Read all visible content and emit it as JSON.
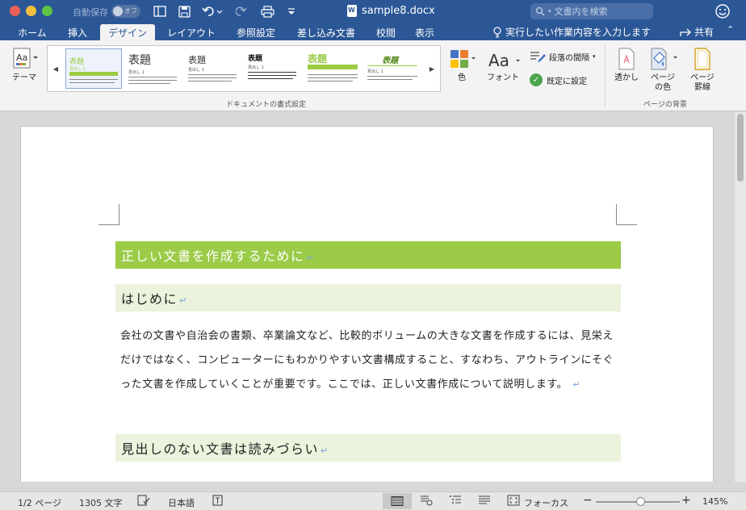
{
  "titlebar": {
    "autosave_label": "自動保存",
    "autosave_state": "オフ",
    "document_title": "sample8.docx",
    "search_placeholder": "文書内を検索"
  },
  "tabs": [
    {
      "label": "ホーム",
      "active": false
    },
    {
      "label": "挿入",
      "active": false
    },
    {
      "label": "デザイン",
      "active": true
    },
    {
      "label": "レイアウト",
      "active": false
    },
    {
      "label": "参照設定",
      "active": false
    },
    {
      "label": "差し込み文書",
      "active": false
    },
    {
      "label": "校閲",
      "active": false
    },
    {
      "label": "表示",
      "active": false
    }
  ],
  "tell_me": "実行したい作業内容を入力します",
  "share": "共有",
  "ribbon": {
    "theme_label": "テーマ",
    "gallery_heading": "表題",
    "gallery_subheading": "見出し 1",
    "group_document_format": "ドキュメントの書式設定",
    "color_label": "色",
    "font_label": "フォント",
    "paragraph_spacing": "段落の間隔",
    "set_default": "既定に設定",
    "watermark": "透かし",
    "page_color": "ページ\nの色",
    "page_borders": "ページ\n罫線",
    "group_page_background": "ページの背景"
  },
  "document": {
    "heading1": "正しい文書を作成するために",
    "heading2a": "はじめに",
    "body": "会社の文書や自治会の書類、卒業論文など、比較的ボリュームの大きな文書を作成するには、見栄えだけではなく、コンピューターにもわかりやすい文書構成すること、すなわち、アウトラインにそぐった文書を作成していくことが重要です。ここでは、正しい文書作成について説明します。",
    "heading2b": "見出しのない文書は読みづらい"
  },
  "statusbar": {
    "page": "1/2 ページ",
    "words": "1305 文字",
    "language": "日本語",
    "focus": "フォーカス",
    "zoom": "145%"
  },
  "colors": {
    "accent": "#2b5796",
    "heading1_bg": "#9bcb47",
    "heading2_bg": "#ebf3dc"
  }
}
